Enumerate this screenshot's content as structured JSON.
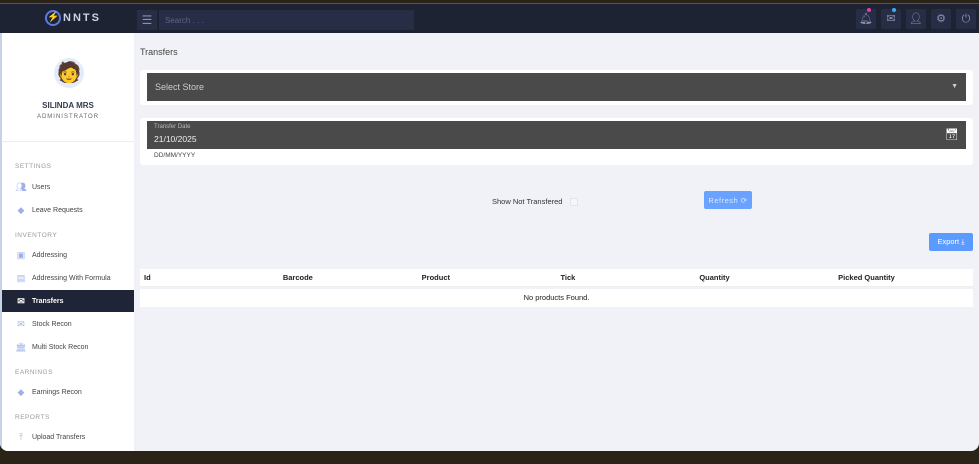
{
  "app": {
    "logo": "NNTS",
    "search_placeholder": "Search . . ."
  },
  "topbar": {
    "icons": [
      "bell-icon",
      "mail-icon",
      "user-icon",
      "gear-icon",
      "power-icon"
    ],
    "notification_color": "#e040a0",
    "mail_dot_color": "#3fa9f5"
  },
  "user": {
    "name": "SILINDA MRS",
    "role": "ADMINISTRATOR"
  },
  "sidebar": {
    "sections": [
      "SETTINGS",
      "INVENTORY",
      "EARNINGS",
      "REPORTS"
    ],
    "items": [
      {
        "label": "Users",
        "icon": "users-icon"
      },
      {
        "label": "Leave Requests",
        "icon": "diamond-icon"
      },
      {
        "label": "Addressing",
        "icon": "contact-icon"
      },
      {
        "label": "Addressing With Formula",
        "icon": "id-card-icon"
      },
      {
        "label": "Transfers",
        "icon": "envelope-open-icon"
      },
      {
        "label": "Stock Recon",
        "icon": "envelope-icon"
      },
      {
        "label": "Multi Stock Recon",
        "icon": "bank-icon"
      },
      {
        "label": "Earnings Recon",
        "icon": "diamond-icon"
      },
      {
        "label": "Upload Transfers",
        "icon": "upload-icon"
      }
    ]
  },
  "main": {
    "title": "Transfers",
    "store_select": "Select Store",
    "date_label": "Transfer Date",
    "date_value": "21/10/2025",
    "date_hint": "DD/MM/YYYY",
    "show_not_transfered": "Show Not Transfered",
    "refresh": "Refresh ⟳",
    "export": "Export ⤓",
    "columns": [
      "Id",
      "Barcode",
      "Product",
      "Tick",
      "Quantity",
      "Picked Quantity"
    ],
    "empty": "No products Found."
  }
}
